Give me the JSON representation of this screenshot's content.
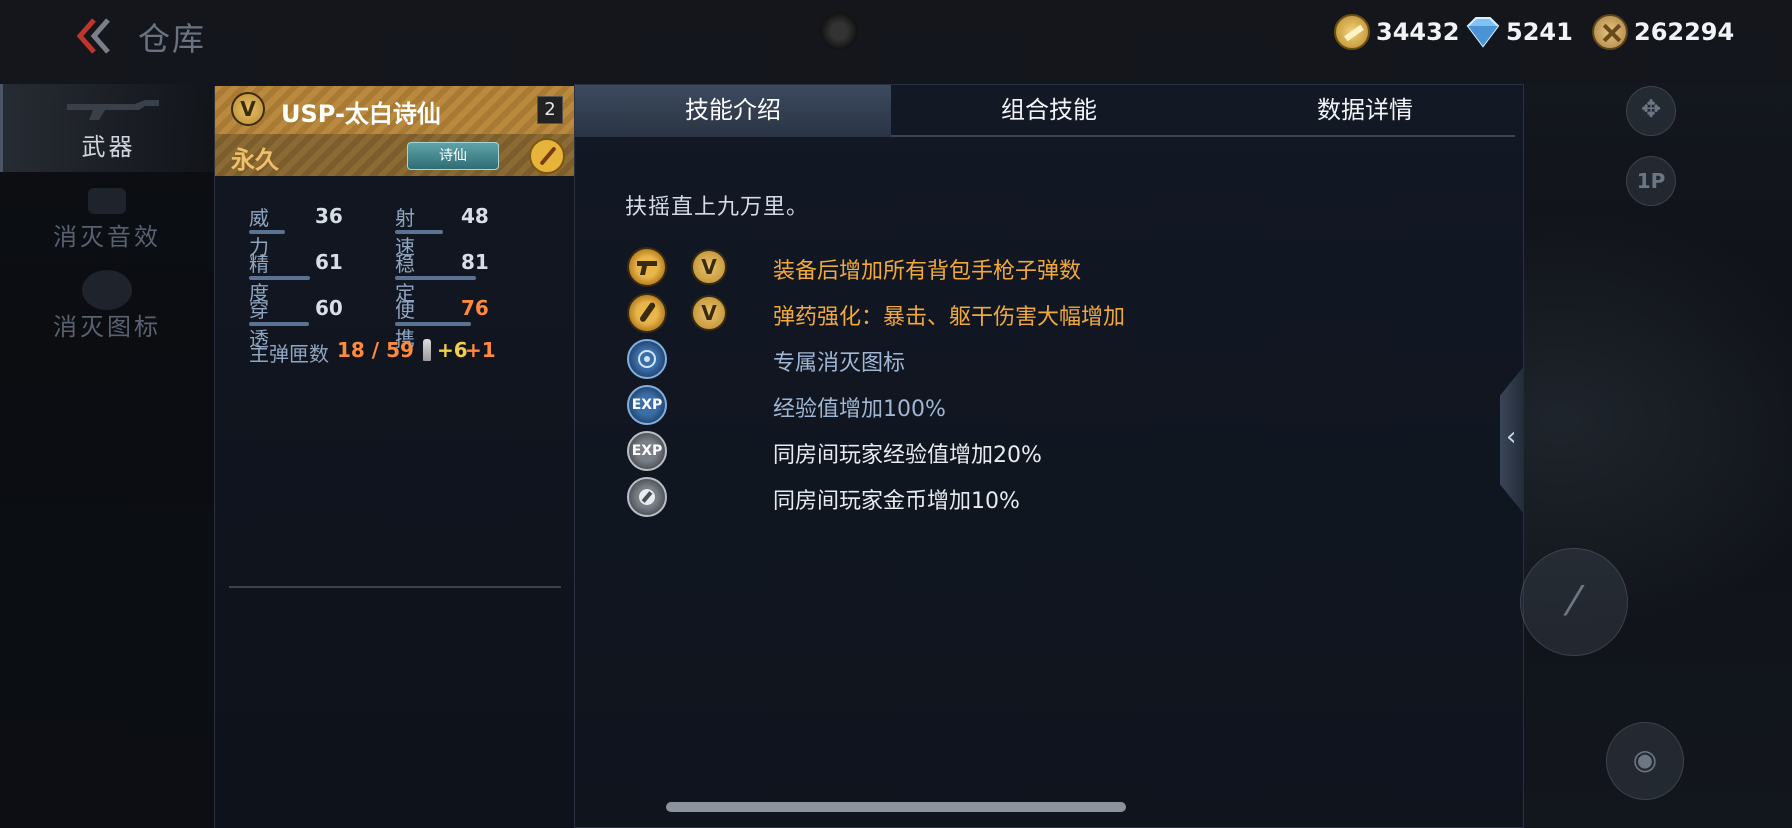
{
  "header": {
    "title": "仓库",
    "currencies": [
      {
        "name": "gold-bar",
        "value": "34432"
      },
      {
        "name": "diamond",
        "value": "5241"
      },
      {
        "name": "medal-coin",
        "value": "262294"
      }
    ]
  },
  "nav": {
    "items": [
      {
        "label": "武器"
      },
      {
        "label": "消灭音效"
      },
      {
        "label": "消灭图标"
      }
    ]
  },
  "weapon": {
    "name": "USP-太白诗仙",
    "level": "2",
    "duration": "永久",
    "tag": "诗仙",
    "stats": [
      {
        "label": "威力",
        "value": "36",
        "fill": 0.36
      },
      {
        "label": "射速",
        "value": "48",
        "fill": 0.48
      },
      {
        "label": "精度",
        "value": "61",
        "fill": 0.61
      },
      {
        "label": "稳定",
        "value": "81",
        "fill": 0.81
      },
      {
        "label": "穿透",
        "value": "60",
        "fill": 0.6
      },
      {
        "label": "便携",
        "value": "76",
        "fill": 0.76
      }
    ],
    "ammo_label": "主弹匣数",
    "ammo_value": "18 / 59",
    "ammo_bonus": "+6",
    "ammo_bonus2": "+1"
  },
  "tabs": [
    {
      "label": "技能介绍"
    },
    {
      "label": "组合技能"
    },
    {
      "label": "数据详情"
    }
  ],
  "skills": {
    "description": "扶摇直上九万里。",
    "list": [
      {
        "icon": "pistol-icon",
        "v_badge": "V",
        "text": "装备后增加所有背包手枪子弹数"
      },
      {
        "icon": "ammo-boost-icon",
        "v_badge": "V",
        "text": "弹药强化：暴击、躯干伤害大幅增加"
      },
      {
        "icon": "kill-icon-badge",
        "text": "专属消灭图标"
      },
      {
        "icon": "exp-boost-icon",
        "icon_text": "EXP",
        "text": "经验值增加100%"
      },
      {
        "icon": "room-exp-icon",
        "icon_text": "EXP",
        "text": "同房间玩家经验值增加20%"
      },
      {
        "icon": "room-coin-icon",
        "text": "同房间玩家金币增加10%"
      }
    ]
  },
  "right": {
    "one_p_label": "1P"
  },
  "colors": {
    "gold_text": "#f2a93b",
    "blue_text": "#9fb6d4",
    "orange_value": "#ff8a3d"
  }
}
